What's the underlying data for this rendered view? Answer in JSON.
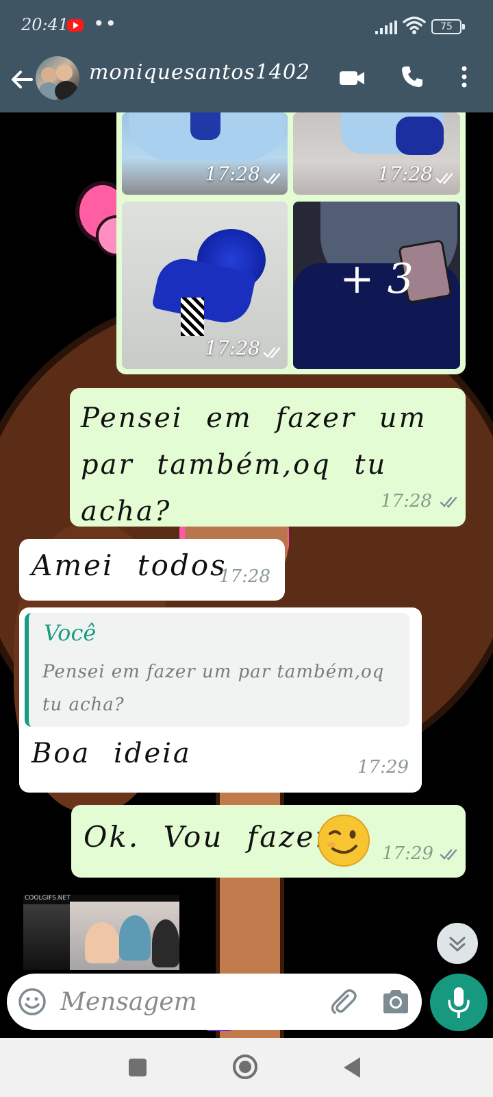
{
  "status_bar": {
    "time": "20:41",
    "dots": "••",
    "battery": "75"
  },
  "header": {
    "contact_name": "moniquesantos1402"
  },
  "album": {
    "photos": [
      {
        "time": "17:28"
      },
      {
        "time": "17:28"
      },
      {
        "time": "17:28"
      },
      {
        "more": "+ 3"
      }
    ]
  },
  "messages": [
    {
      "id": "m1",
      "direction": "outgoing",
      "text": "Pensei em fazer um par também,oq tu acha?",
      "time": "17:28",
      "status": "read"
    },
    {
      "id": "m2",
      "direction": "incoming",
      "text": "Amei todos",
      "time": "17:28"
    },
    {
      "id": "m3",
      "direction": "incoming",
      "reply_author": "Você",
      "reply_text": "Pensei em fazer um par também,oq tu acha?",
      "text": "Boa ideia",
      "time": "17:29"
    },
    {
      "id": "m4",
      "direction": "outgoing",
      "text": "Ok. Vou fazer",
      "emoji": "☺",
      "time": "17:29",
      "status": "read"
    }
  ],
  "sticker": {
    "label": "COOLGIFS.NET"
  },
  "composer": {
    "placeholder": "Mensagem"
  },
  "colors": {
    "header": "#3f5563",
    "outgoing_bubble": "#e3fcd3",
    "incoming_bubble": "#ffffff",
    "accent": "#17997f",
    "read_ticks": "#7d8c98"
  }
}
